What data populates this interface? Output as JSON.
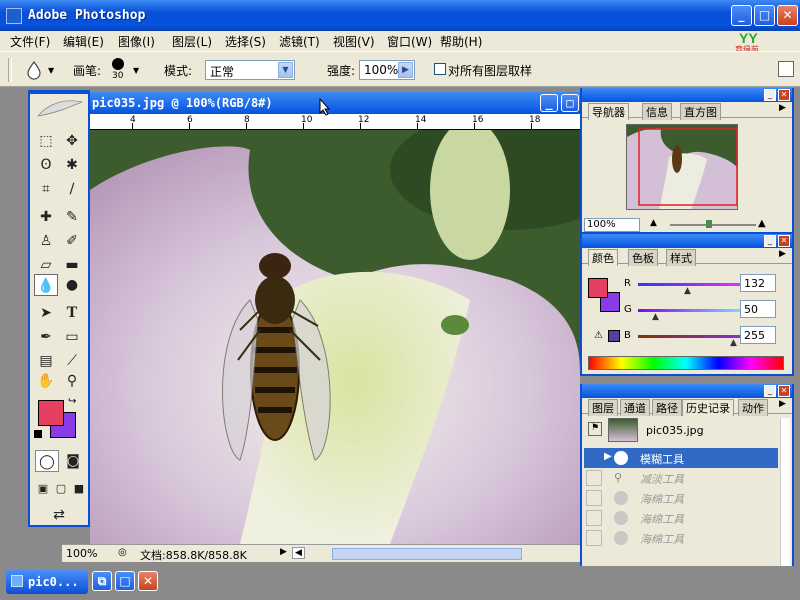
{
  "app": {
    "title": "Adobe Photoshop"
  },
  "menu": [
    "文件(F)",
    "编辑(E)",
    "图像(I)",
    "图层(L)",
    "选择(S)",
    "滤镜(T)",
    "视图(V)",
    "窗口(W)",
    "帮助(H)"
  ],
  "logo_text": "育缘苑",
  "options": {
    "brush_label": "画笔:",
    "brush_size": "30",
    "mode_label": "模式:",
    "mode_value": "正常",
    "strength_label": "强度:",
    "strength_value": "100%",
    "sample_all_label": "对所有图层取样"
  },
  "document": {
    "title": "pic035.jpg @ 100%(RGB/8#)",
    "ruler_ticks": [
      "4",
      "6",
      "8",
      "10",
      "12",
      "14",
      "16",
      "18"
    ],
    "zoom": "100%",
    "status": "文档:858.8K/858.8K"
  },
  "navigator": {
    "tabs": [
      "导航器",
      "信息",
      "直方图"
    ],
    "zoom": "100%"
  },
  "color_panel": {
    "tabs": [
      "颜色",
      "色板",
      "样式"
    ],
    "r_label": "R",
    "r_value": "132",
    "g_label": "G",
    "g_value": "50",
    "b_label": "B",
    "b_value": "255",
    "fg_color": "#e64060",
    "bg_color": "#8a3be8"
  },
  "history_panel": {
    "tabs": [
      "图层",
      "通道",
      "路径",
      "历史记录",
      "动作"
    ],
    "snapshot": "pic035.jpg",
    "items": [
      "模糊工具",
      "减淡工具",
      "海绵工具",
      "海绵工具",
      "海绵工具"
    ]
  },
  "taskbar": {
    "item": "pic0..."
  }
}
